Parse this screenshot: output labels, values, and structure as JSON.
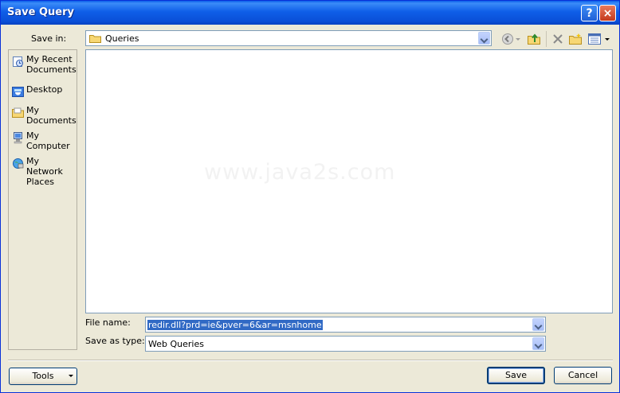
{
  "window": {
    "title": "Save Query"
  },
  "titlebar": {
    "help_label": "?",
    "close_label": "×"
  },
  "save_in": {
    "label": "Save in:",
    "value": "Queries"
  },
  "places": [
    {
      "label": "My Recent Documents",
      "icon": "recent-documents-icon"
    },
    {
      "label": "Desktop",
      "icon": "desktop-icon"
    },
    {
      "label": "My Documents",
      "icon": "my-documents-icon"
    },
    {
      "label": "My Computer",
      "icon": "my-computer-icon"
    },
    {
      "label": "My Network Places",
      "icon": "network-places-icon"
    }
  ],
  "watermark": "www.java2s.com",
  "file_name": {
    "label": "File name:",
    "value": "redir.dll?prd=ie&pver=6&ar=msnhome"
  },
  "save_as_type": {
    "label": "Save as type:",
    "value": "Web Queries"
  },
  "buttons": {
    "tools": "Tools",
    "save": "Save",
    "cancel": "Cancel"
  },
  "colors": {
    "titlebar": "#0a5dea",
    "dialog_bg": "#ece9d8",
    "selection": "#316ac5"
  }
}
